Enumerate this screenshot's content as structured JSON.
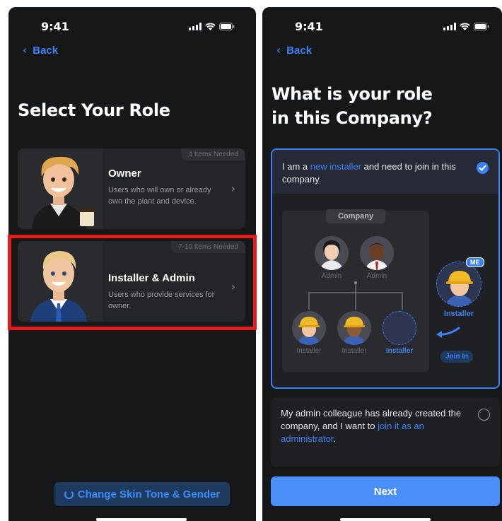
{
  "left_screen": {
    "status": {
      "time": "9:41"
    },
    "back_label": "Back",
    "title": "Select Your Role",
    "roles": [
      {
        "name": "Owner",
        "badge": "4 Items Needed",
        "description": "Users who will own or already own the plant and device."
      },
      {
        "name": "Installer & Admin",
        "badge": "7-10 Items Needed",
        "description": "Users who provide services for owner."
      }
    ],
    "skin_button_label": "Change Skin Tone & Gender",
    "highlight_color": "#e51b1b"
  },
  "right_screen": {
    "status": {
      "time": "9:41"
    },
    "back_label": "Back",
    "title_line1": "What is your role",
    "title_line2": "in this Company?",
    "option1": {
      "text_before": "I am a ",
      "link": "new installer",
      "text_after": " and need to join in this company.",
      "selected": true
    },
    "diagram": {
      "company_label": "Company",
      "admin_labels": [
        "Admin",
        "Admin"
      ],
      "installer_labels": [
        "Installer",
        "Installer",
        "Installer"
      ],
      "me_badge": "ME",
      "me_label": "Installer",
      "join_label": "Join In"
    },
    "option2": {
      "text_before": "My admin colleague has already created the company, and I want to ",
      "link": "join it as an administrator",
      "text_after": ".",
      "selected": false
    },
    "next_label": "Next"
  },
  "colors": {
    "accent": "#3b82f6",
    "background": "#161719",
    "card": "#242528"
  }
}
